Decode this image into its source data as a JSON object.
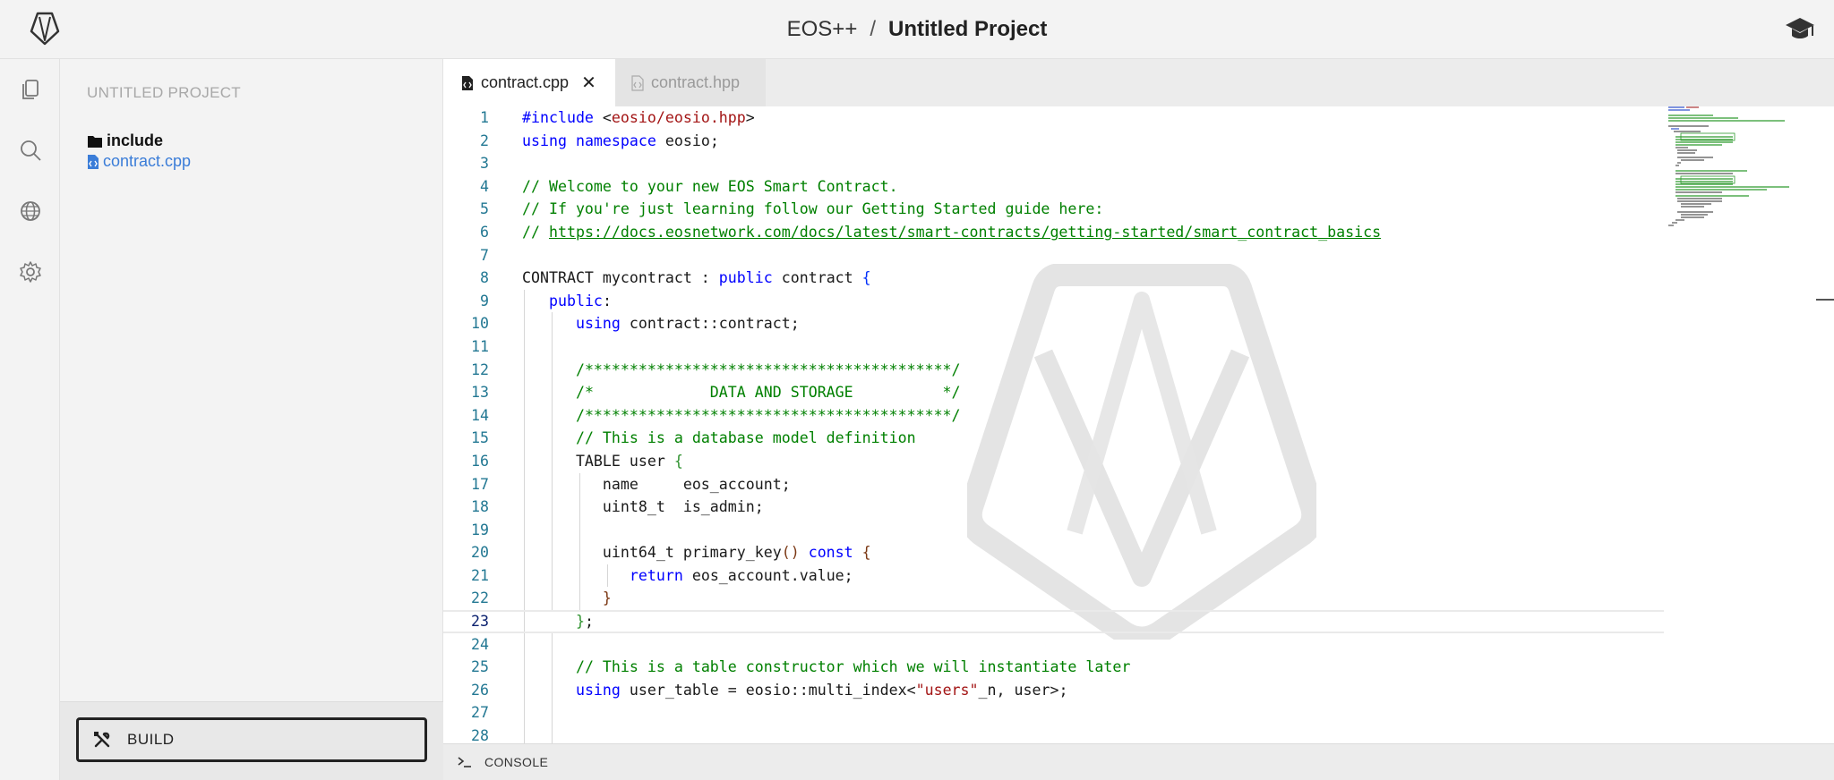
{
  "header": {
    "app_name": "EOS++",
    "separator": "/",
    "project_name": "Untitled Project"
  },
  "activity_bar": {
    "items": [
      "files-icon",
      "search-icon",
      "globe-icon",
      "settings-icon"
    ]
  },
  "sidebar": {
    "title": "UNTITLED PROJECT",
    "tree": [
      {
        "type": "folder",
        "label": "include"
      },
      {
        "type": "file",
        "label": "contract.cpp"
      }
    ],
    "build_label": "BUILD"
  },
  "tabs": [
    {
      "label": "contract.cpp",
      "active": true
    },
    {
      "label": "contract.hpp",
      "active": false
    }
  ],
  "editor": {
    "current_line": 23
  },
  "console": {
    "label": "CONSOLE"
  },
  "colors": {
    "link": "#3b7dd8",
    "comment": "#008000",
    "keyword": "#0000ff",
    "string": "#a31515"
  }
}
